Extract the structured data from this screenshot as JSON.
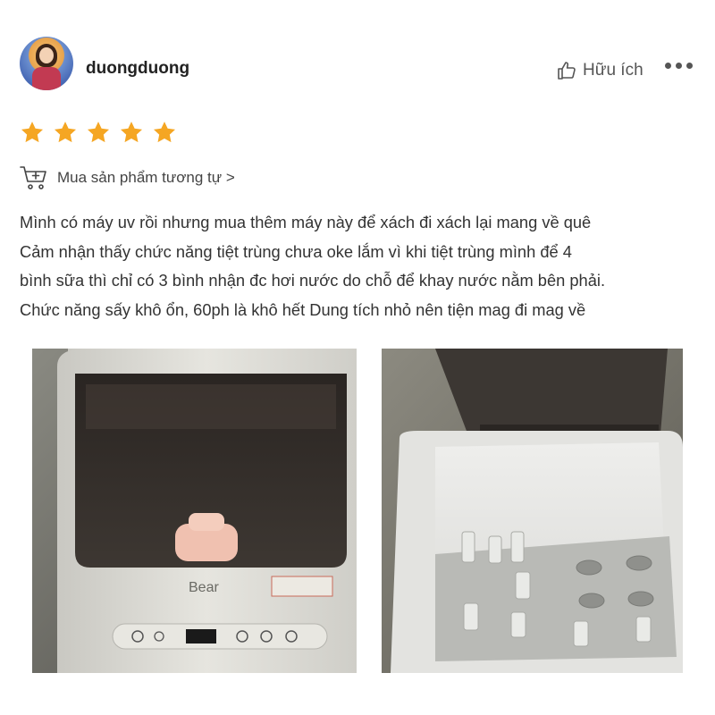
{
  "user": {
    "name": "duongduong"
  },
  "actions": {
    "helpful_label": "Hữu ích"
  },
  "rating": {
    "stars": 5,
    "max": 5,
    "star_color": "#f5a623"
  },
  "buy_similar": {
    "label": "Mua sản phẩm tương tự >"
  },
  "review": {
    "lines": [
      "Mình có máy uv rồi nhưng mua thêm máy này để xách đi xách lại mang về quê",
      "Cảm nhận thấy chức năng tiệt trùng chưa oke lắm vì khi tiệt trùng mình để 4",
      "bình sữa thì chỉ có 3 bình nhận đc hơi nước do chỗ để khay nước nằm bên phải.",
      "Chức năng sấy khô ổn, 60ph là khô hết Dung tích nhỏ nên tiện mag đi mag về"
    ]
  },
  "photos": {
    "photo1": {
      "brand": "Bear"
    },
    "photo2": {}
  }
}
